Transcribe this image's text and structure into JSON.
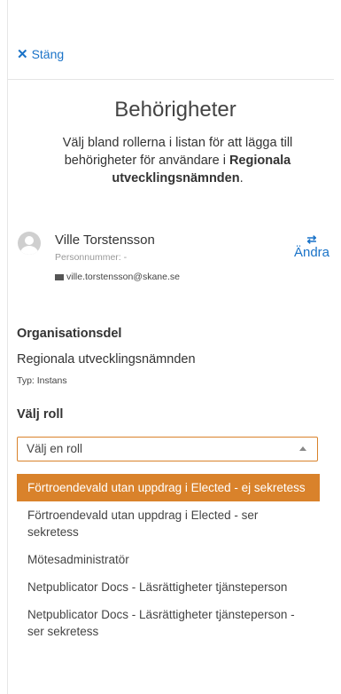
{
  "header": {
    "close_label": "Stäng"
  },
  "dialog": {
    "title": "Behörigheter",
    "intro_prefix": "Välj bland rollerna i listan för att lägga till behörigheter för användare i",
    "intro_bold": "Regionala utvecklingsnämnden",
    "intro_suffix": "."
  },
  "user": {
    "name": "Ville Torstensson",
    "personnummer": "Personnummer: -",
    "email": "ville.torstensson@skane.se",
    "change_label": "Ändra"
  },
  "organisation": {
    "heading": "Organisationsdel",
    "value": "Regionala utvecklingsnämnden",
    "type": "Typ: Instans"
  },
  "role": {
    "heading": "Välj roll",
    "placeholder": "Välj en roll",
    "options": [
      {
        "label": "Förtroendevald utan uppdrag i Elected - ej sekretess",
        "highlighted": true
      },
      {
        "label": "Förtroendevald utan uppdrag i Elected - ser sekretess",
        "highlighted": false
      },
      {
        "label": "Mötesadministratör",
        "highlighted": false
      },
      {
        "label": "Netpublicator Docs - Läsrättigheter tjänsteperson",
        "highlighted": false
      },
      {
        "label": "Netpublicator Docs - Läsrättigheter tjänsteperson - ser sekretess",
        "highlighted": false
      }
    ]
  },
  "colors": {
    "link": "#1a73c8",
    "accent": "#d9822b"
  },
  "icons": {
    "close": "close-icon",
    "change": "swap-arrows-icon",
    "mail": "envelope-icon",
    "avatar": "user-avatar-icon",
    "caret": "caret-up-icon"
  }
}
